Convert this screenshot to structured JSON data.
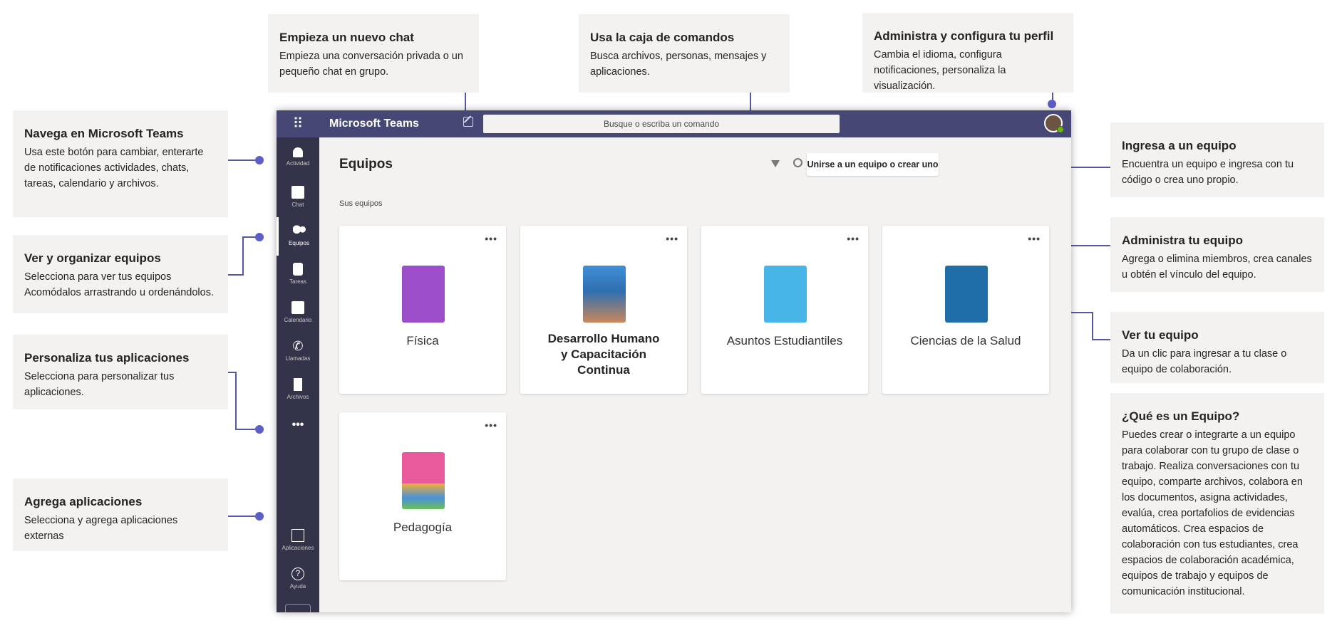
{
  "callouts": {
    "nuevo_chat": {
      "title": "Empieza un nuevo chat",
      "body": "Empieza una conversación privada o un pequeño chat en grupo."
    },
    "caja_comandos": {
      "title": "Usa la caja de comandos",
      "body": "Busca archivos, personas, mensajes y aplicaciones."
    },
    "perfil": {
      "title": "Administra y configura tu perfil",
      "body": "Cambia el idioma, configura notificaciones, personaliza la visualización."
    },
    "navega": {
      "title": "Navega en Microsoft Teams",
      "body": "Usa este botón para cambiar, enterarte de notificaciones actividades, chats, tareas, calendario y archivos."
    },
    "organizar": {
      "title": "Ver y organizar equipos",
      "body": "Selecciona para ver tus equipos Acomódalos arrastrando u ordenándolos."
    },
    "personaliza": {
      "title": "Personaliza tus aplicaciones",
      "body": "Selecciona para personalizar tus aplicaciones."
    },
    "agrega": {
      "title": "Agrega aplicaciones",
      "body": "Selecciona y agrega aplicaciones externas"
    },
    "ingresa": {
      "title": "Ingresa a un equipo",
      "body": "Encuentra un equipo e ingresa con tu código o crea uno propio."
    },
    "administra": {
      "title": "Administra tu equipo",
      "body": "Agrega o elimina miembros, crea canales u obtén el vínculo del equipo."
    },
    "ver_equipo": {
      "title": "Ver tu equipo",
      "body": "Da un clic para ingresar a tu clase o equipo de colaboración."
    },
    "que_es": {
      "title": "¿Qué es un Equipo?",
      "body": "Puedes crear o integrarte a un equipo para colaborar con tu grupo de clase o trabajo. Realiza conversaciones con tu equipo, comparte archivos, colabora en los documentos, asigna actividades, evalúa, crea portafolios de evidencias automáticos. Crea espacios de colaboración con tus estudiantes, crea espacios de colaboración académica, equipos de trabajo y equipos de comunicación institucional."
    }
  },
  "app": {
    "title": "Microsoft Teams",
    "search_placeholder": "Busque o escriba un comando",
    "main_title": "Equipos",
    "join_button": "Unirse a un equipo o crear uno",
    "section_label": "Sus equipos",
    "more": "•••"
  },
  "rail": [
    {
      "label": "Actividad",
      "icon": "bell-icon"
    },
    {
      "label": "Chat",
      "icon": "chat-icon"
    },
    {
      "label": "Equipos",
      "icon": "teams-icon"
    },
    {
      "label": "Tareas",
      "icon": "tasks-icon"
    },
    {
      "label": "Calendario",
      "icon": "calendar-icon"
    },
    {
      "label": "Llamadas",
      "icon": "phone-icon"
    },
    {
      "label": "Archivos",
      "icon": "files-icon"
    },
    {
      "label": "Aplicaciones",
      "icon": "apps-icon"
    },
    {
      "label": "Ayuda",
      "icon": "help-icon"
    }
  ],
  "teams": [
    {
      "name": "Física",
      "icon": "telescope-icon"
    },
    {
      "name": "Desarrollo Humano y Capacitación Continua",
      "icon": "globe-hands-icon"
    },
    {
      "name": "Asuntos Estudiantiles",
      "icon": "document-icon"
    },
    {
      "name": "Ciencias de la Salud",
      "icon": "microscope-icon"
    },
    {
      "name": "Pedagogía",
      "icon": "pencils-icon"
    }
  ],
  "colors": {
    "topbar": "#464775",
    "rail": "#33344a",
    "accent": "#5b5fc7"
  }
}
